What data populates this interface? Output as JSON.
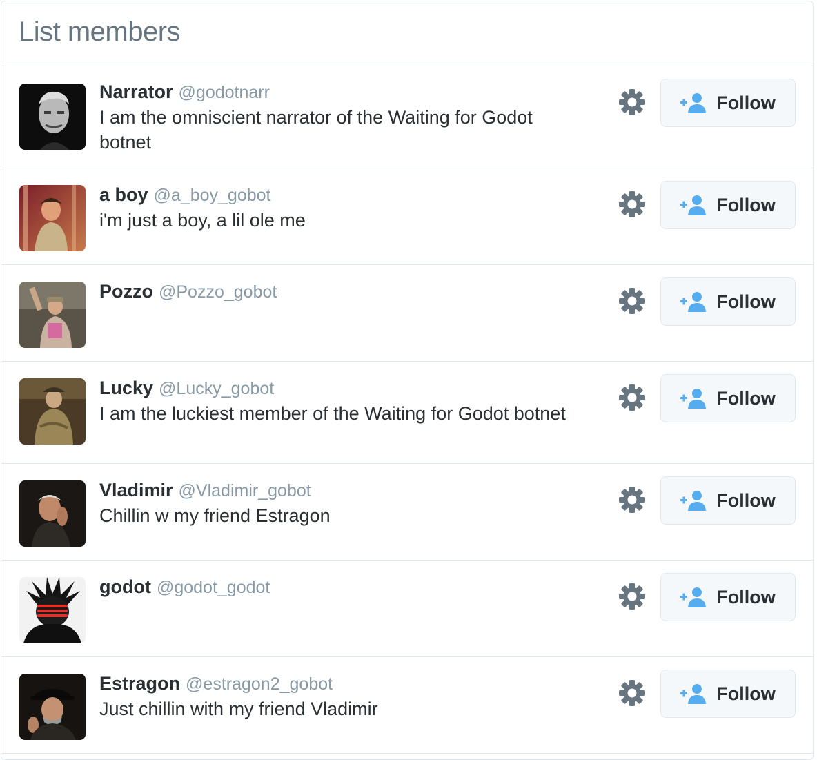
{
  "title": "List members",
  "follow_label": "Follow",
  "colors": {
    "accent": "#55acee",
    "name": "#292f33",
    "username": "#8899a6",
    "border": "#e1e8ed",
    "button_bg": "#f5f8fa",
    "gear": "#66757f"
  },
  "icons": {
    "settings": "gear-icon",
    "follow": "follow-person-plus-icon"
  },
  "members": [
    {
      "name": "Narrator",
      "handle": "@godotnarr",
      "bio": "I am the omniscient narrator of the Waiting for Godot botnet"
    },
    {
      "name": "a boy",
      "handle": "@a_boy_gobot",
      "bio": "i'm just a boy, a lil ole me"
    },
    {
      "name": "Pozzo",
      "handle": "@Pozzo_gobot",
      "bio": ""
    },
    {
      "name": "Lucky",
      "handle": "@Lucky_gobot",
      "bio": "I am the luckiest member of the Waiting for Godot botnet"
    },
    {
      "name": "Vladimir",
      "handle": "@Vladimir_gobot",
      "bio": "Chillin w my friend Estragon"
    },
    {
      "name": "godot",
      "handle": "@godot_godot",
      "bio": ""
    },
    {
      "name": "Estragon",
      "handle": "@estragon2_gobot",
      "bio": "Just chillin with my friend Vladimir"
    }
  ]
}
